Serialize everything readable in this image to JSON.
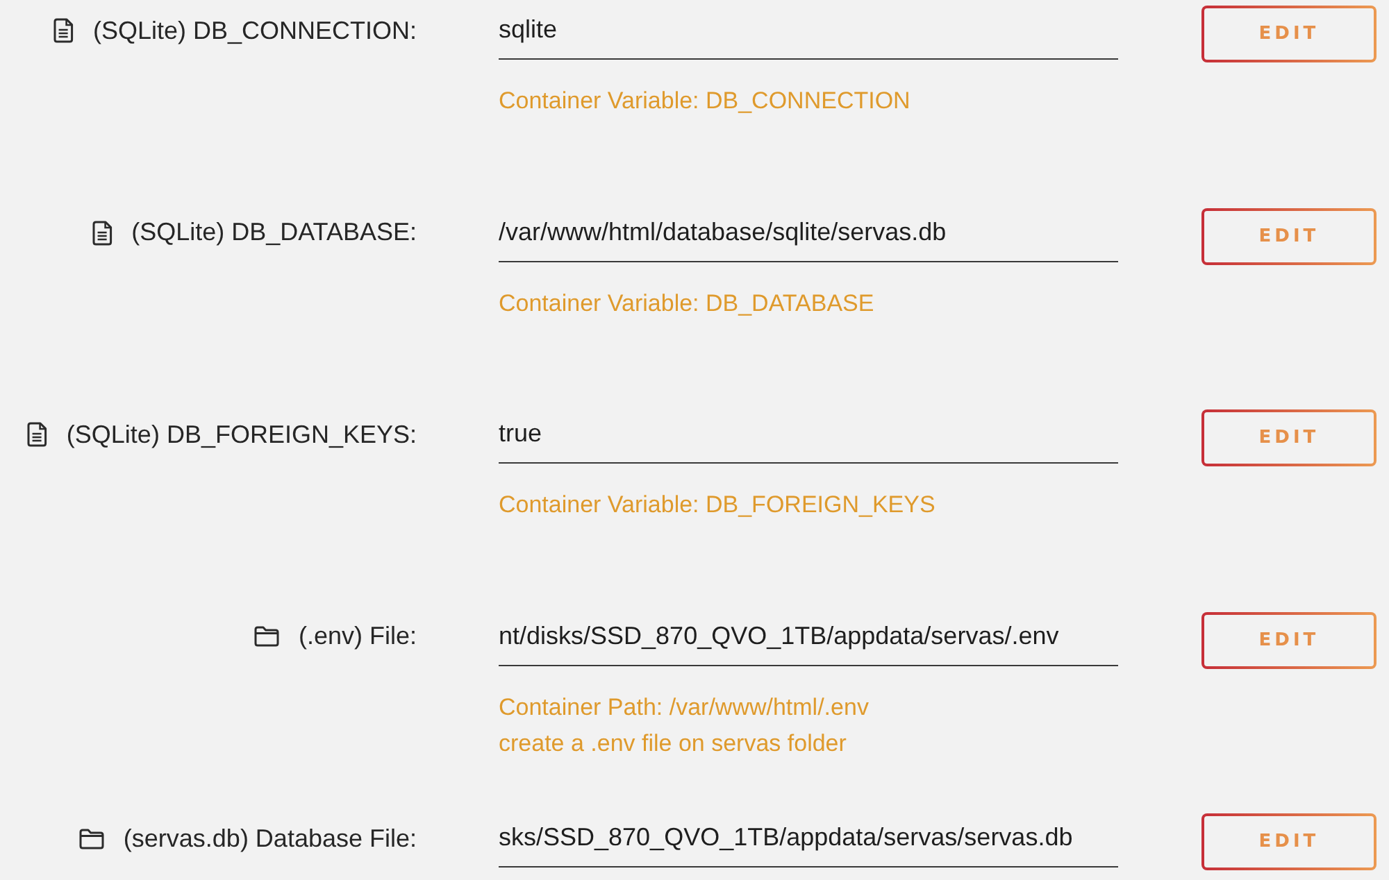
{
  "rows": [
    {
      "kind": "document",
      "label": "(SQLite) DB_CONNECTION:",
      "value": "sqlite",
      "hints": [
        "Container Variable: DB_CONNECTION"
      ],
      "button": "EDIT"
    },
    {
      "kind": "document",
      "label": "(SQLite) DB_DATABASE:",
      "value": "/var/www/html/database/sqlite/servas.db",
      "hints": [
        "Container Variable: DB_DATABASE"
      ],
      "button": "EDIT"
    },
    {
      "kind": "document",
      "label": "(SQLite) DB_FOREIGN_KEYS:",
      "value": "true",
      "hints": [
        "Container Variable: DB_FOREIGN_KEYS"
      ],
      "button": "EDIT"
    },
    {
      "kind": "folder",
      "label": "(.env) File:",
      "value": "nt/disks/SSD_870_QVO_1TB/appdata/servas/.env",
      "hints": [
        "Container Path: /var/www/html/.env",
        "create a .env file on servas folder"
      ],
      "button": "EDIT"
    },
    {
      "kind": "folder",
      "label": "(servas.db) Database File:",
      "value": "sks/SSD_870_QVO_1TB/appdata/servas/servas.db",
      "hints": [],
      "button": "EDIT"
    }
  ]
}
